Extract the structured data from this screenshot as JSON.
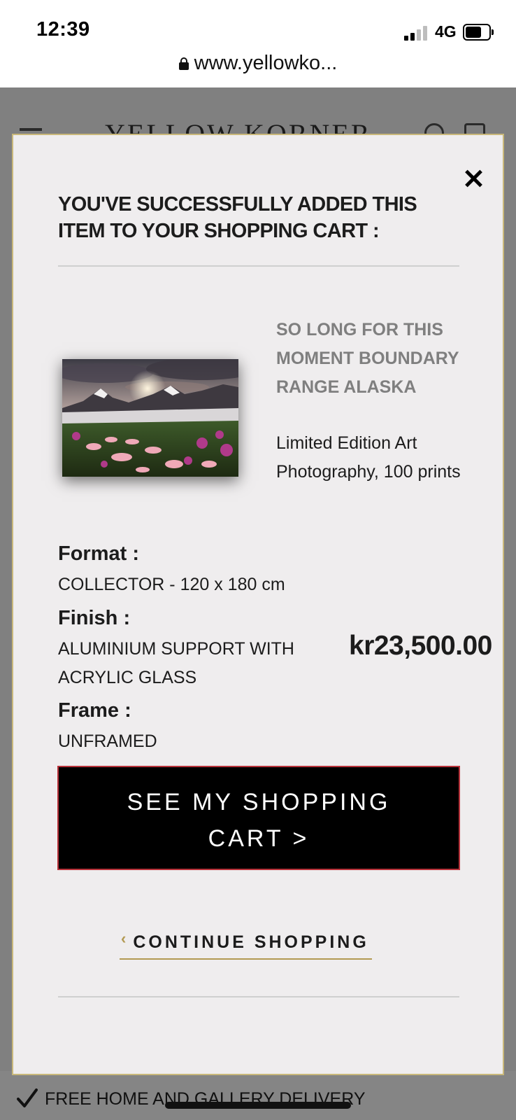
{
  "status_bar": {
    "time": "12:39",
    "network": "4G"
  },
  "browser": {
    "url": "www.yellowko..."
  },
  "background_page": {
    "logo": "YELLOW KORNER",
    "delivery_text": "FREE HOME AND GALLERY DELIVERY"
  },
  "modal": {
    "title": "YOU'VE SUCCESSFULLY ADDED THIS ITEM TO YOUR SHOPPING CART :",
    "product": {
      "name": "SO LONG FOR THIS MOMENT BOUNDARY RANGE ALASKA",
      "description": "Limited Edition Art Photography, 100 prints",
      "image_icon": "landscape-photo"
    },
    "options": {
      "format_label": "Format :",
      "format_value": "COLLECTOR - 120 x 180 cm",
      "finish_label": "Finish :",
      "finish_value": "ALUMINIUM SUPPORT WITH ACRYLIC GLASS",
      "frame_label": "Frame :",
      "frame_value": "UNFRAMED"
    },
    "price": "kr23,500.00",
    "cart_button_label": "SEE MY SHOPPING CART >",
    "continue_label": "CONTINUE SHOPPING",
    "continue_icon": "chevron-left-icon",
    "close_icon": "close-icon"
  },
  "colors": {
    "overlay": "#808080",
    "modal_bg": "#efedee",
    "modal_border": "#c9b87a",
    "accent_gold": "#b39a52",
    "button_bg": "#000000",
    "button_border": "#b8323a",
    "product_name": "#7f7f7f"
  }
}
